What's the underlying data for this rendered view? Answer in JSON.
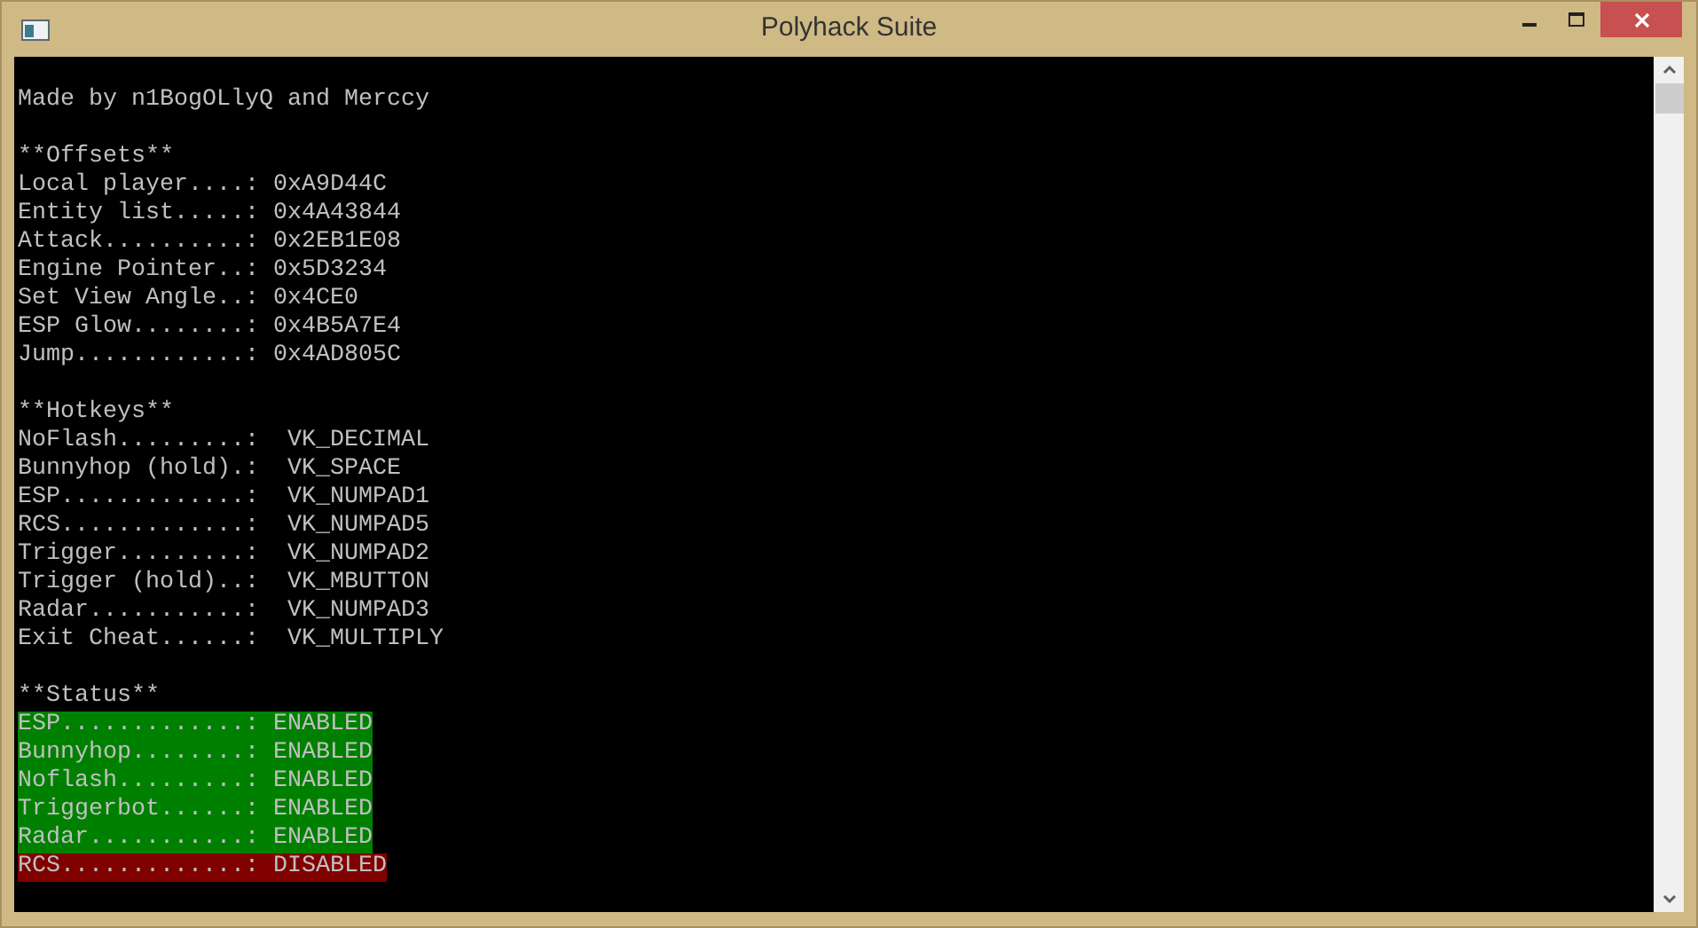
{
  "window": {
    "title": "Polyhack Suite"
  },
  "console": {
    "credits": "Made by n1BogOLlyQ and Merccy",
    "offsets": {
      "heading": "**Offsets**",
      "lines": [
        "Local player....: 0xA9D44C",
        "Entity list.....: 0x4A43844",
        "Attack..........: 0x2EB1E08",
        "Engine Pointer..: 0x5D3234",
        "Set View Angle..: 0x4CE0",
        "ESP Glow........: 0x4B5A7E4",
        "Jump............: 0x4AD805C"
      ]
    },
    "hotkeys": {
      "heading": "**Hotkeys**",
      "lines": [
        "NoFlash.........:  VK_DECIMAL",
        "Bunnyhop (hold).:  VK_SPACE",
        "ESP.............:  VK_NUMPAD1",
        "RCS.............:  VK_NUMPAD5",
        "Trigger.........:  VK_NUMPAD2",
        "Trigger (hold)..:  VK_MBUTTON",
        "Radar...........:  VK_NUMPAD3",
        "Exit Cheat......:  VK_MULTIPLY"
      ]
    },
    "status": {
      "heading": "**Status**",
      "lines": [
        {
          "text": "ESP.............: ENABLED",
          "enabled": true
        },
        {
          "text": "Bunnyhop........: ENABLED",
          "enabled": true
        },
        {
          "text": "Noflash.........: ENABLED",
          "enabled": true
        },
        {
          "text": "Triggerbot......: ENABLED",
          "enabled": true
        },
        {
          "text": "Radar...........: ENABLED",
          "enabled": true
        },
        {
          "text": "RCS.............: DISABLED",
          "enabled": false
        }
      ]
    }
  }
}
